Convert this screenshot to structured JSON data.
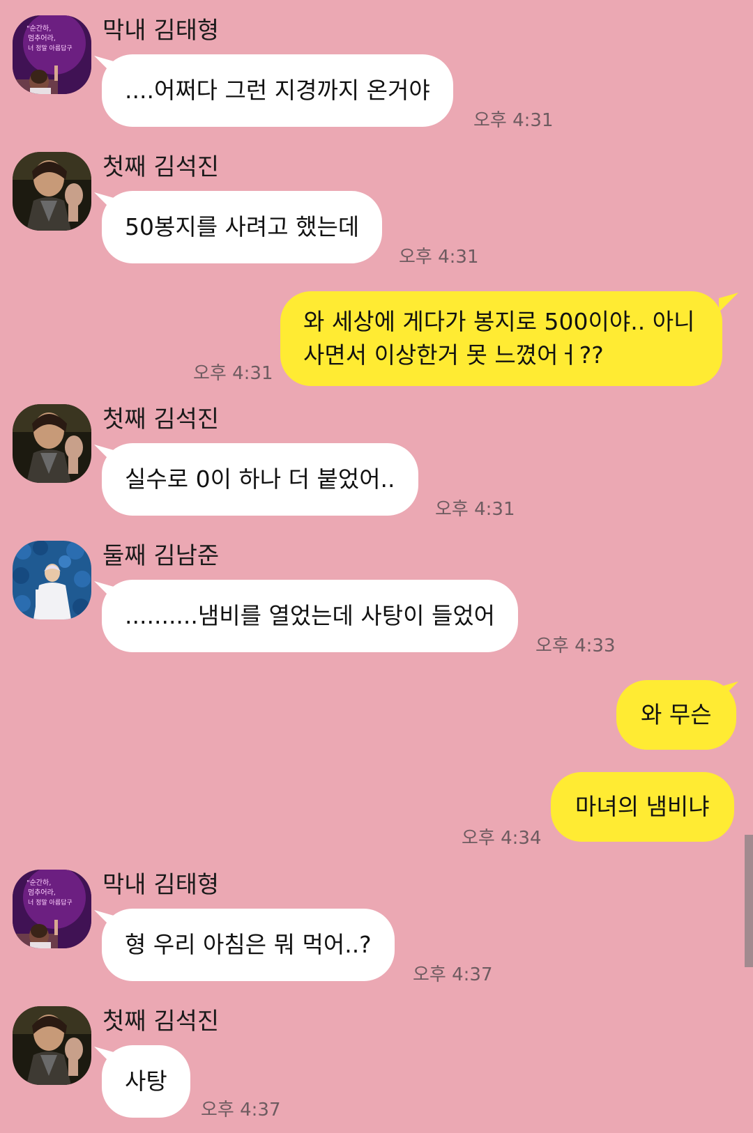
{
  "chat": {
    "colors": {
      "background": "#eba8b3",
      "incoming_bubble": "#ffffff",
      "outgoing_bubble": "#ffeb33",
      "timestamp": "#6e5b60"
    },
    "messages": [
      {
        "sender": "막내 김태형",
        "avatar": "neon-sign-avatar",
        "text": "....어쩌다 그런 지경까지 온거야",
        "time": "오후 4:31"
      },
      {
        "sender": "첫째 김석진",
        "avatar": "waving-man-avatar",
        "text": "50봉지를 사려고 했는데",
        "time": "오후 4:31"
      },
      {
        "line1": "와 세상에 게다가 봉지로 500이야.. 아니",
        "line2": "사면서 이상한거 못 느꼈어ㅓ??",
        "time": "오후 4:31"
      },
      {
        "sender": "첫째 김석진",
        "avatar": "waving-man-avatar",
        "text": "실수로 0이 하나 더 붙었어..",
        "time": "오후 4:31"
      },
      {
        "sender": "둘째 김남준",
        "avatar": "blue-roses-avatar",
        "text": "..........냄비를 열었는데 사탕이 들었어",
        "time": "오후 4:33"
      },
      {
        "text": "와 무슨"
      },
      {
        "text": "마녀의 냄비냐",
        "time": "오후 4:34"
      },
      {
        "sender": "막내 김태형",
        "avatar": "neon-sign-avatar",
        "text": "형 우리 아침은 뭐 먹어..?",
        "time": "오후 4:37"
      },
      {
        "sender": "첫째 김석진",
        "avatar": "waving-man-avatar",
        "text": "사탕",
        "time": "오후 4:37"
      }
    ]
  },
  "avatar_art": {
    "neon_sign_lines": [
      "\"순간하,",
      "멈추어라,",
      "너 정말 아름답구"
    ]
  }
}
